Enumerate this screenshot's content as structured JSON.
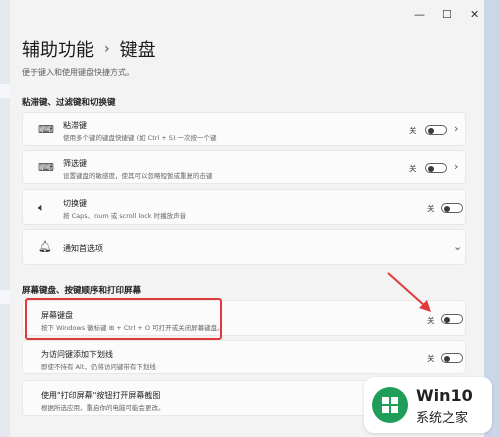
{
  "window": {
    "minimize": "—",
    "maximize": "☐",
    "close": "✕"
  },
  "header": {
    "parent": "辅助功能",
    "current": "键盘",
    "subtitle": "便于键入和使用键盘快捷方式。"
  },
  "sections": {
    "s1": "粘滞键、过滤键和切换键",
    "s2": "屏幕键盘、按键顺序和打印屏幕"
  },
  "cards": {
    "sticky": {
      "title": "粘滞键",
      "desc": "使用多个键的键盘快捷键 (如 Ctrl + S) 一次按一个键",
      "state": "关"
    },
    "filter": {
      "title": "筛选键",
      "desc": "设置键盘的敏感度，使其可以忽略短暂或重复的击键",
      "state": "关"
    },
    "toggle": {
      "title": "切换键",
      "desc": "按 Caps、num 或 scroll lock 时播放声音",
      "state": "关"
    },
    "notify": {
      "title": "通知首选项"
    },
    "osk": {
      "title": "屏幕键盘",
      "desc": "按下 Windows 徽标键 ⊞ + Ctrl + O 可打开或关闭屏幕键盘。",
      "state": "关"
    },
    "access": {
      "title": "为访问键添加下划线",
      "desc": "即使不持有 Alt，仍将访问键带有下划线",
      "state": "关"
    },
    "prtsc": {
      "title": "使用\"打印屏幕\"按钮打开屏幕截图",
      "desc": "根据所选应用，重启你的电脑可能会更改。"
    }
  },
  "watermark": {
    "line1": "Win10",
    "line2": "系统之家"
  }
}
